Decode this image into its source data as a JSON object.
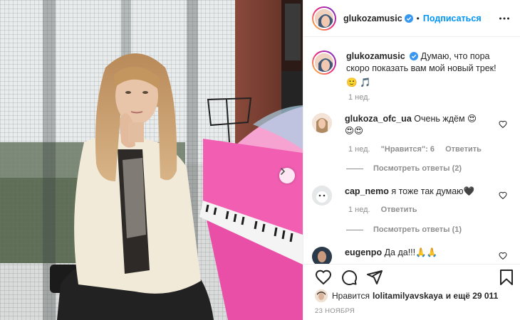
{
  "post": {
    "author": "glukozamusic",
    "follow_label": "Подписаться",
    "dot": "•",
    "caption": "Думаю, что пора скоро показать вам мой новый трек!",
    "caption_emoji": "🙂 🎵",
    "caption_time": "1 нед.",
    "likes_prefix": "Нравится",
    "likes_user": "lolitamilyavskaya",
    "likes_suffix": "и ещё 29 011",
    "date": "23 НОЯБРЯ"
  },
  "comments": [
    {
      "user": "glukoza_ofc_ua",
      "text": "Очень ждём 😍",
      "text2": "😍😍",
      "time": "1 нед.",
      "likes": "\"Нравится\": 6",
      "reply": "Ответить",
      "view_replies": "Посмотреть ответы (2)"
    },
    {
      "user": "cap_nemo",
      "text": "я тоже так думаю🖤",
      "time": "1 нед.",
      "reply": "Ответить",
      "view_replies": "Посмотреть ответы (1)"
    },
    {
      "user": "eugenpo",
      "text": "Да да!!!🙏🙏"
    }
  ],
  "colors": {
    "accent": "#0095f6",
    "piano": "#f25fb2",
    "muted": "#8e8e8e"
  },
  "icons": [
    "verified-icon",
    "more-icon",
    "heart-icon",
    "comment-icon",
    "share-icon",
    "bookmark-icon",
    "chevron-right-icon"
  ]
}
